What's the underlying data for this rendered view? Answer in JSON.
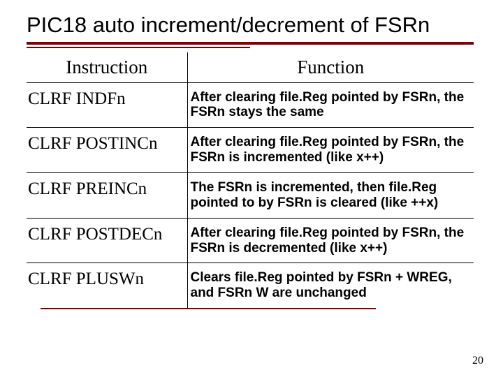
{
  "title": "PIC18 auto increment/decrement of FSRn",
  "headers": {
    "instruction": "Instruction",
    "function": "Function"
  },
  "rows": [
    {
      "instr": "CLRF  INDFn",
      "func": "After clearing file.Reg pointed by FSRn, the FSRn stays the same"
    },
    {
      "instr": "CLRF  POSTINCn",
      "func": "After clearing file.Reg pointed by FSRn, the FSRn is incremented (like x++)"
    },
    {
      "instr": "CLRF  PREINCn",
      "func": "The FSRn is incremented, then file.Reg pointed to by FSRn is cleared (like ++x)"
    },
    {
      "instr": "CLRF  POSTDECn",
      "func": "After clearing file.Reg pointed by FSRn, the FSRn is decremented (like x++)"
    },
    {
      "instr": "CLRF  PLUSWn",
      "func": "Clears file.Reg pointed by FSRn + WREG, and FSRn W are unchanged"
    }
  ],
  "page_number": "20"
}
